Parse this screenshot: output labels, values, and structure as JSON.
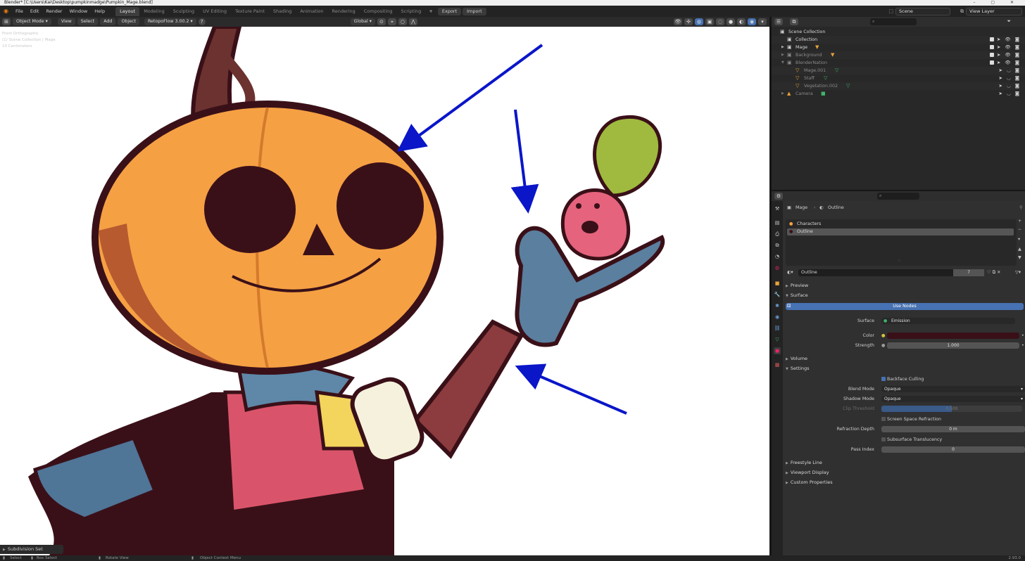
{
  "window": {
    "title": "Blender* [C:\\Users\\Kai\\Desktop\\pumpkinmadge\\Pumpkin_Mage.blend]"
  },
  "menu": [
    "File",
    "Edit",
    "Render",
    "Window",
    "Help"
  ],
  "workspaces": [
    "Layout",
    "Modeling",
    "Sculpting",
    "UV Editing",
    "Texture Paint",
    "Shading",
    "Animation",
    "Rendering",
    "Compositing",
    "Scripting"
  ],
  "topbar": {
    "export_label": "Export",
    "import_label": "Import",
    "scene": "Scene",
    "view_layer": "View Layer",
    "add_ws": "+"
  },
  "viewport_header": {
    "mode": "Object Mode",
    "menus": [
      "View",
      "Select",
      "Add",
      "Object"
    ],
    "addon": "RetopoFlow 3.00.2",
    "transform": "Global"
  },
  "viewport": {
    "info": [
      "Front Orthographic",
      "(1) Scene Collection | Mage",
      "10 Centimeters"
    ],
    "last_operator": "Subdivision Set"
  },
  "statusbar": {
    "select": "Select",
    "box_select": "Box Select",
    "rotate": "Rotate View",
    "context": "Object Context Menu",
    "version": "2.93.0"
  },
  "outliner": {
    "root": "Scene Collection",
    "rows": [
      {
        "label": "Collection",
        "indent": 1
      },
      {
        "label": "Mage",
        "indent": 1
      },
      {
        "label": "Background",
        "indent": 1
      },
      {
        "label": "BlenderNation",
        "indent": 1
      },
      {
        "label": "Mage.001",
        "indent": 2
      },
      {
        "label": "Staff",
        "indent": 2
      },
      {
        "label": "Vegetation.002",
        "indent": 2
      },
      {
        "label": "Camera",
        "indent": 1
      }
    ]
  },
  "properties": {
    "breadcrumb_object": "Mage",
    "breadcrumb_material": "Outline",
    "slots": [
      "Characters",
      "Outline"
    ],
    "material_name": "Outline",
    "user_count": "7",
    "sections": {
      "preview": "Preview",
      "surface": "Surface",
      "volume": "Volume",
      "settings": "Settings",
      "freestyle": "Freestyle Line",
      "viewport_display": "Viewport Display",
      "custom": "Custom Properties"
    },
    "use_nodes": "Use Nodes",
    "surface_label": "Surface",
    "surface_value": "Emission",
    "color_label": "Color",
    "color_value": "#3a1018",
    "strength_label": "Strength",
    "strength_value": "1.000",
    "backface_culling": "Backface Culling",
    "blend_mode_label": "Blend Mode",
    "blend_mode_value": "Opaque",
    "shadow_mode_label": "Shadow Mode",
    "shadow_mode_value": "Opaque",
    "clip_label": "Clip Threshold",
    "clip_value": "0.500",
    "ssr": "Screen Space Refraction",
    "refraction_depth_label": "Refraction Depth",
    "refraction_depth_value": "0 m",
    "subsurface": "Subsurface Translucency",
    "pass_index_label": "Pass Index",
    "pass_index_value": "0"
  },
  "colors": {
    "accent": "#4772b3",
    "arrow": "#0a16c8",
    "pumpkin": "#f5a043",
    "outline": "#3a1018"
  }
}
